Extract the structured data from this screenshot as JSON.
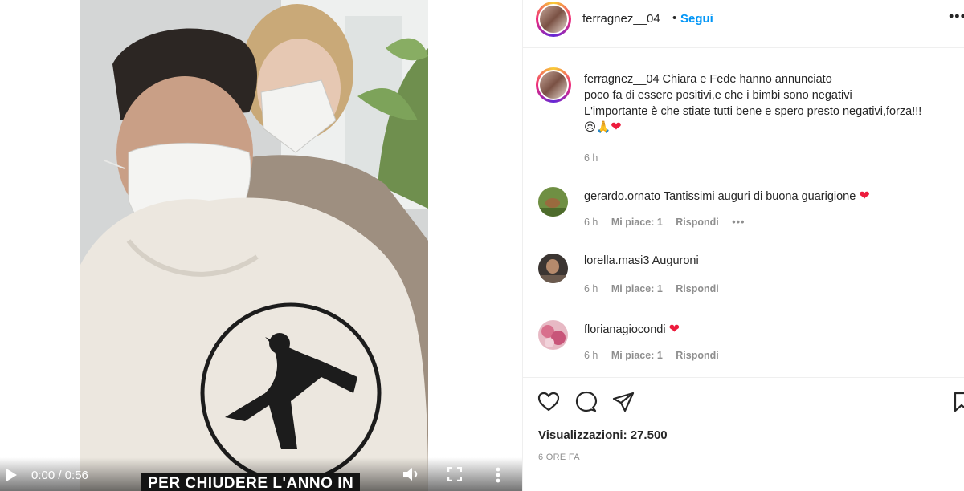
{
  "video": {
    "time": "0:00 / 0:56",
    "caption": "PER CHIUDERE L'ANNO IN",
    "controls": {
      "play": "play-icon",
      "volume": "volume-icon",
      "fullscreen": "fullscreen-icon",
      "more": "more-vertical-icon"
    }
  },
  "header": {
    "username": "ferragnez__04",
    "separator": "•",
    "follow_label": "Segui",
    "more_label": "•••"
  },
  "post": {
    "username": "ferragnez__04",
    "lines": [
      "Chiara e Fede hanno annunciato",
      "poco fa di essere positivi,e che i bimbi sono negativi",
      "L'importante è che stiate tutti bene e spero presto negativi,forza!!!"
    ],
    "emojis": [
      "😣",
      "🙏",
      "❤"
    ],
    "time": "6 h"
  },
  "comments": [
    {
      "username": "gerardo.ornato",
      "text": "Tantissimi auguri di buona guarigione",
      "heart": "❤",
      "time": "6 h",
      "likes": "Mi piace: 1",
      "reply": "Rispondi",
      "more": "•••"
    },
    {
      "username": "lorella.masi3",
      "text": "Auguroni",
      "heart": "",
      "time": "6 h",
      "likes": "Mi piace: 1",
      "reply": "Rispondi",
      "more": ""
    },
    {
      "username": "florianagiocondi",
      "text": "",
      "heart": "❤",
      "time": "6 h",
      "likes": "Mi piace: 1",
      "reply": "Rispondi",
      "more": ""
    }
  ],
  "actions": {
    "icons": [
      "heart-icon",
      "comment-icon",
      "share-icon",
      "bookmark-icon"
    ],
    "views": "Visualizzazioni: 27.500",
    "ago": "6 ORE FA"
  },
  "colors": {
    "accent": "#0095f6",
    "text": "#262626",
    "muted": "#8e8e8e",
    "heart": "#ed1c3d",
    "border": "#efefef"
  }
}
